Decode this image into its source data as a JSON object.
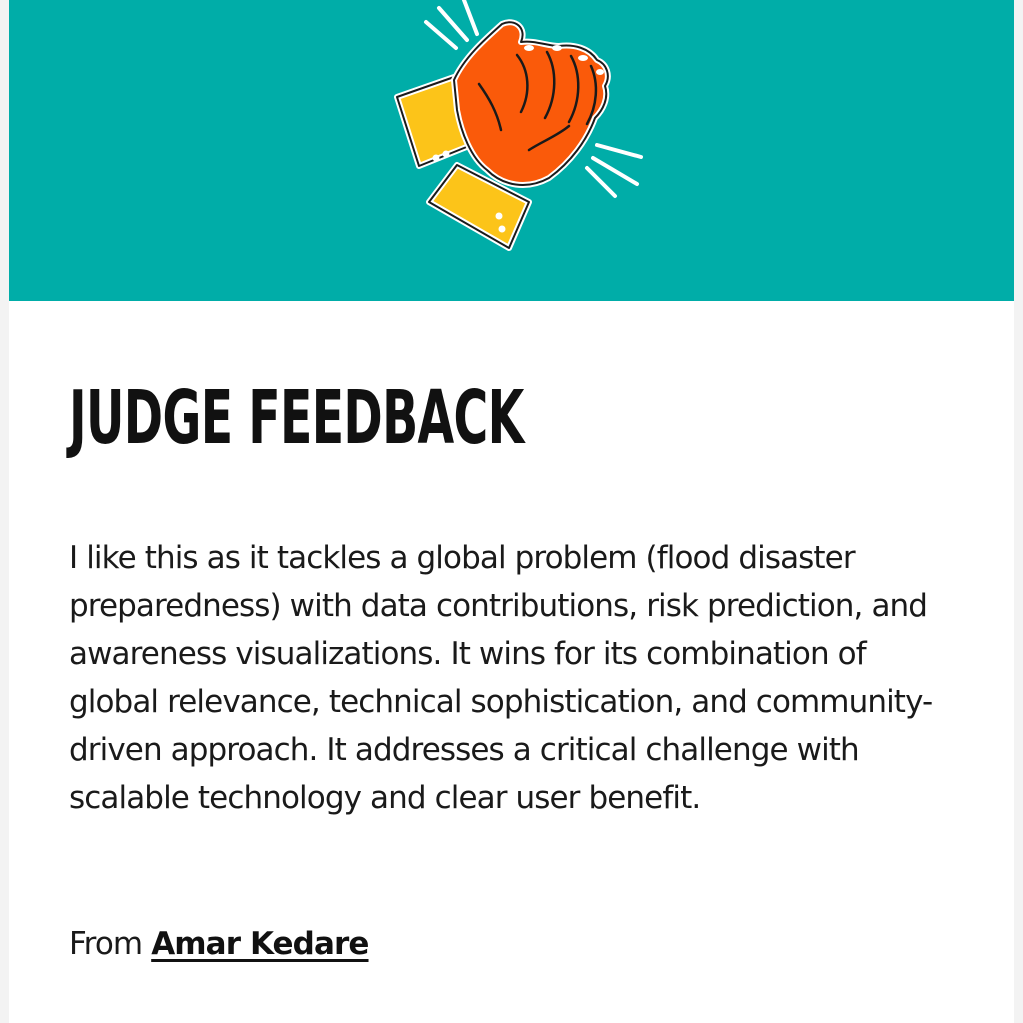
{
  "header": {
    "illustration_icon": "clapping-hands-icon",
    "background_color": "#00ada8"
  },
  "title": "JUDGE FEEDBACK",
  "feedback_text": "I like this as it tackles a global problem (flood disaster preparedness) with data contributions, risk prediction, and awareness visualizations. It wins for its combination of global relevance, technical sophistication, and community-driven approach. It addresses a critical challenge with scalable technology and clear user benefit.",
  "attribution": {
    "prefix": "From",
    "author_name": "Amar Kedare"
  }
}
